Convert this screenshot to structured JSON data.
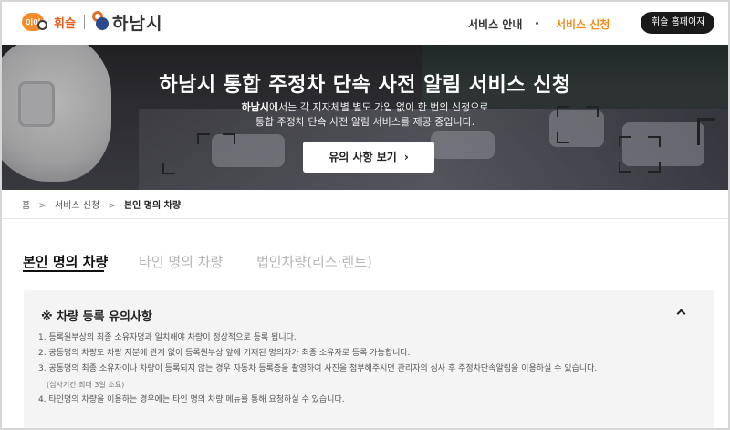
{
  "header": {
    "brand_logo_text": "이이",
    "brand_name": "휘슬",
    "city_name": "하남시",
    "nav": [
      "서비스 안내",
      "서비스 신청"
    ],
    "home_button": "휘슬 홈페이지",
    "home_button_arrow": "›",
    "active_color": "#f08c1f"
  },
  "hero": {
    "title": "하남시 통합 주정차 단속 사전 알림 서비스 신청",
    "desc_bold": "하남시",
    "desc_line1_rest": "에서는 각 지자체별 별도 가입 없이 한 번의 신청으로",
    "desc_line2": "통합 주정차 단속 사전 알림 서비스를 제공 중입니다.",
    "button": "유의 사항 보기",
    "button_arrow": "›"
  },
  "breadcrumb": {
    "items": [
      "홈",
      "서비스 신청",
      "본인 명의 차량"
    ],
    "separator": ">"
  },
  "tabs": {
    "items": [
      "본인 명의 차량",
      "타인 명의 차량",
      "법인차량(리스·렌트)"
    ],
    "active": 0
  },
  "notice": {
    "title": "※ 차량 등록 유의사항",
    "items": [
      "1. 등록원부상의 최종 소유자명과 일치해야 차량이 정상적으로 등록 됩니다.",
      "2. 공동명의 차량도 차량 지분에 관계 없이 등록원부상 앞에 기재된 명의자가 최종 소유자로 등록 가능합니다.",
      "3. 공동명의 최종 소유자이나 차량이 등록되지 않는 경우 자동차 등록증을 촬영하여 사진을 첨부해주시면 관리자의 심사 후 주정차단속알림을 이용하실 수 있습니다.",
      "4. 타인명의 차량을 이용하는 경우에는 타인 명의 차량 메뉴를 통해 요청하실 수 있습니다."
    ],
    "sub_note": "(심사기간 최대 3일 소요)"
  }
}
